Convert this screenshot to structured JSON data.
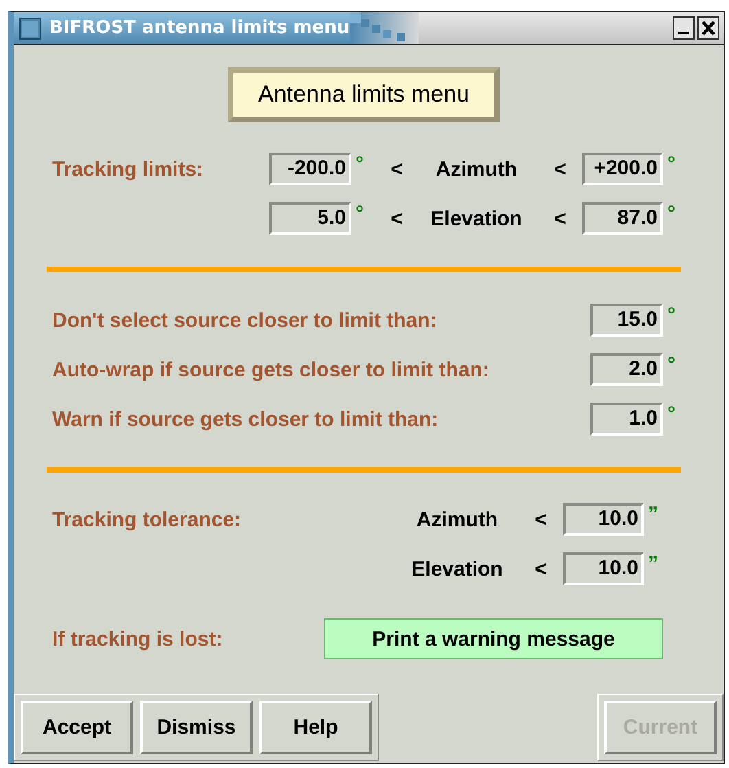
{
  "window": {
    "title": "BIFROST antenna limits menu"
  },
  "heading": "Antenna limits menu",
  "tracking_limits": {
    "label": "Tracking limits:",
    "rows": [
      {
        "min": "-200.0",
        "min_unit": "°",
        "lt_1": "<",
        "axis": "Azimuth",
        "lt_2": "<",
        "max": "+200.0",
        "max_unit": "°"
      },
      {
        "min": "5.0",
        "min_unit": "°",
        "lt_1": "<",
        "axis": "Elevation",
        "lt_2": "<",
        "max": "87.0",
        "max_unit": "°"
      }
    ]
  },
  "margins": [
    {
      "label": "Don't select source closer to limit than:",
      "value": "15.0",
      "unit": "°"
    },
    {
      "label": "Auto-wrap if source gets closer to limit than:",
      "value": "2.0",
      "unit": "°"
    },
    {
      "label": "Warn if source gets closer to limit than:",
      "value": "1.0",
      "unit": "°"
    }
  ],
  "tolerance": {
    "label": "Tracking tolerance:",
    "rows": [
      {
        "axis": "Azimuth",
        "lt": "<",
        "value": "10.0",
        "unit": "”"
      },
      {
        "axis": "Elevation",
        "lt": "<",
        "value": "10.0",
        "unit": "”"
      }
    ]
  },
  "tracking_lost": {
    "label": "If tracking is lost:",
    "action": "Print a warning message"
  },
  "buttons": [
    {
      "label": "Accept",
      "disabled": false
    },
    {
      "label": "Dismiss",
      "disabled": false
    },
    {
      "label": "Help",
      "disabled": false
    },
    {
      "label": "Current",
      "disabled": true
    }
  ]
}
